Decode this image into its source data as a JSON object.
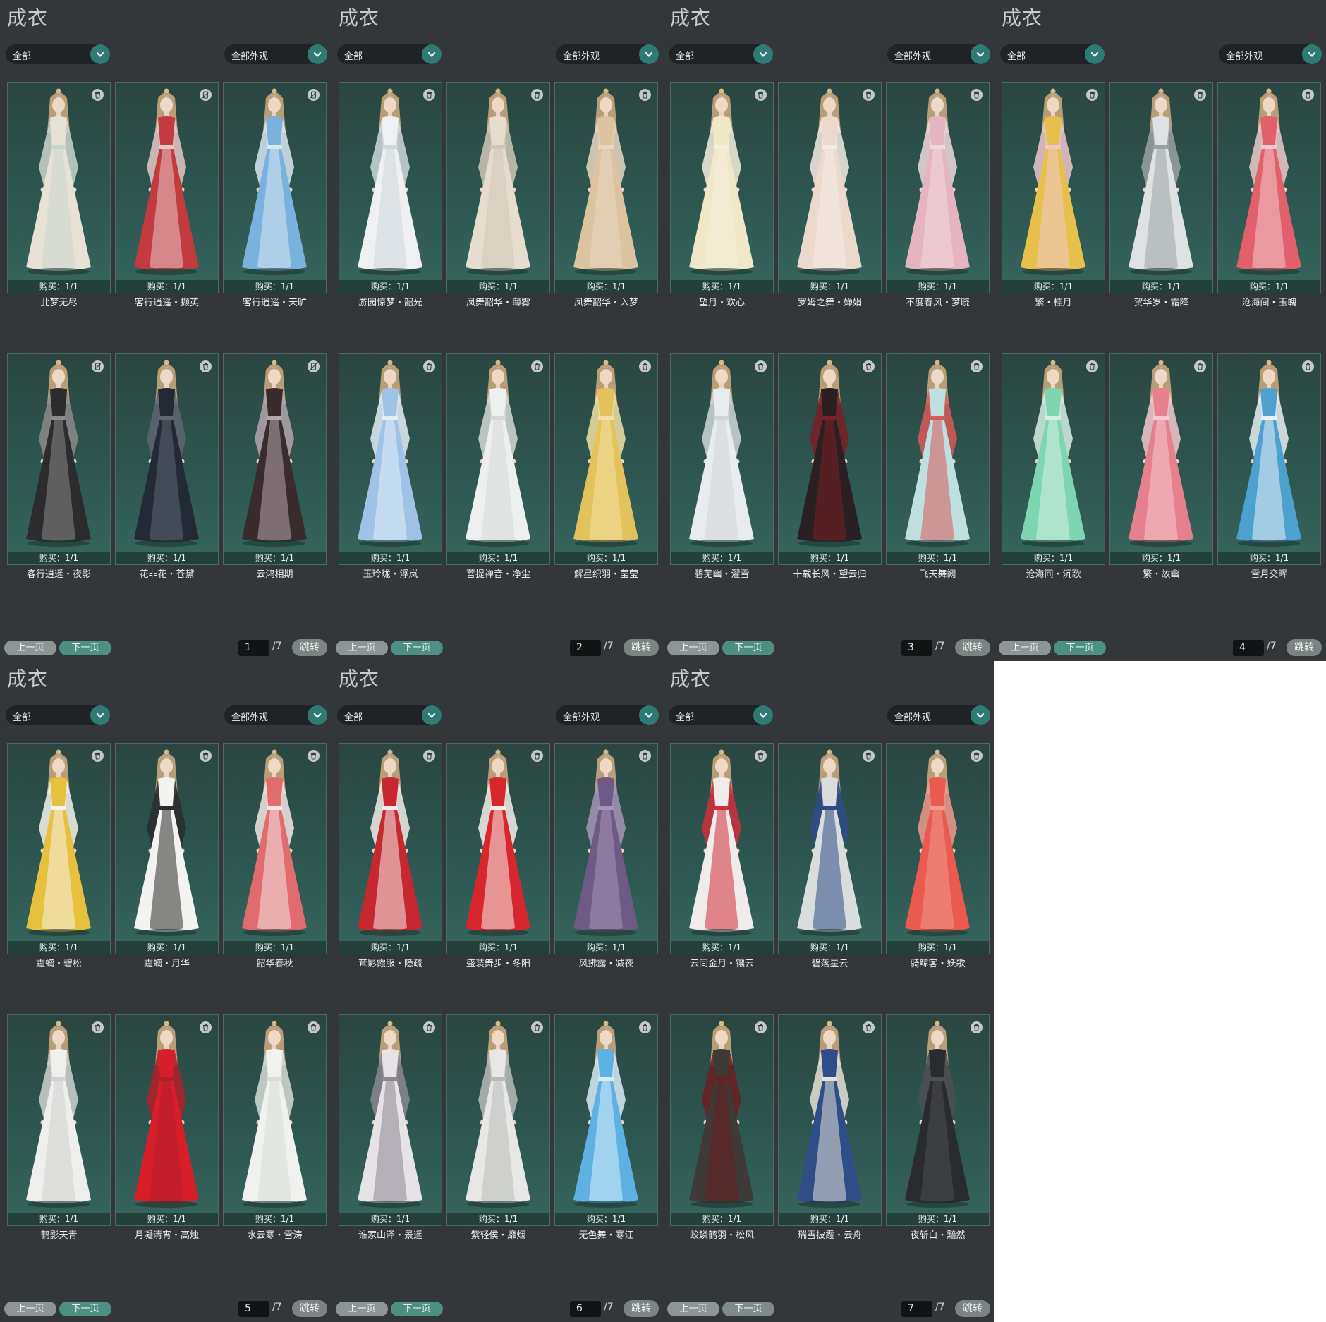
{
  "colors": {
    "panel_bg": "#34373a",
    "card_bg": "#2d5650",
    "accent": "#2f7a74",
    "next_button": "#4d8f83",
    "prev_button": "#8d9695"
  },
  "panels": [
    {
      "title": "成衣",
      "filter_left": "全部",
      "filter_right": "全部外观",
      "items": [
        {
          "name": "此梦无尽",
          "purchase": "购买：1/1",
          "palette": [
            "#e8e2d6",
            "#c9d6cf"
          ]
        },
        {
          "name": "客行逍遥・撷英",
          "purchase": "购买：1/1",
          "palette": [
            "#c23b3f",
            "#e6c7c8"
          ]
        },
        {
          "name": "客行逍遥・天旷",
          "purchase": "购买：1/1",
          "palette": [
            "#78b2dd",
            "#d8e8f1"
          ]
        },
        {
          "name": "客行逍遥・夜影",
          "purchase": "购买：1/1",
          "palette": [
            "#2c2c2f",
            "#8c8a88"
          ]
        },
        {
          "name": "花非花・苍黛",
          "purchase": "购买：1/1",
          "palette": [
            "#232a36",
            "#5f6671"
          ]
        },
        {
          "name": "云鸿相期",
          "purchase": "购买：1/1",
          "palette": [
            "#3a2c2c",
            "#b2a6ad"
          ]
        }
      ],
      "pagination": {
        "prev_label": "上一页",
        "next_label": "下一页",
        "current_page": "1",
        "total": "/7",
        "jump_label": "跳转"
      }
    },
    {
      "title": "成衣",
      "filter_left": "全部",
      "filter_right": "全部外观",
      "items": [
        {
          "name": "游园惊梦・韶光",
          "purchase": "购买：1/1",
          "palette": [
            "#eef0f2",
            "#cfd7dc"
          ]
        },
        {
          "name": "凤舞韶华・薄雾",
          "purchase": "购买：1/1",
          "palette": [
            "#e6ddcf",
            "#cfc7b8"
          ]
        },
        {
          "name": "凤舞韶华・入梦",
          "purchase": "购买：1/1",
          "palette": [
            "#dcc39f",
            "#e8d8bf"
          ]
        },
        {
          "name": "玉玲珑・浮岚",
          "purchase": "购买：1/1",
          "palette": [
            "#9fc3e6",
            "#e3eef7"
          ]
        },
        {
          "name": "菩提禅音・净尘",
          "purchase": "购买：1/1",
          "palette": [
            "#eef0ef",
            "#d5d8d6"
          ]
        },
        {
          "name": "解星织羽・莹莹",
          "purchase": "购买：1/1",
          "palette": [
            "#e4c25b",
            "#f1e1a4"
          ]
        }
      ],
      "pagination": {
        "prev_label": "上一页",
        "next_label": "下一页",
        "current_page": "2",
        "total": "/7",
        "jump_label": "跳转"
      }
    },
    {
      "title": "成衣",
      "filter_left": "全部",
      "filter_right": "全部外观",
      "items": [
        {
          "name": "望月・欢心",
          "purchase": "购买：1/1",
          "palette": [
            "#efe7c6",
            "#f4efdd"
          ]
        },
        {
          "name": "罗姆之舞・婵娟",
          "purchase": "购买：1/1",
          "palette": [
            "#ecd9ce",
            "#f3ebe6"
          ]
        },
        {
          "name": "不度春风・梦晓",
          "purchase": "购买：1/1",
          "palette": [
            "#e6b4c1",
            "#f0d9dd"
          ]
        },
        {
          "name": "碧芜幽・濯雪",
          "purchase": "购买：1/1",
          "palette": [
            "#e9ecee",
            "#cfd6d9"
          ]
        },
        {
          "name": "十载长风・望云归",
          "purchase": "购买：1/1",
          "palette": [
            "#2a1f22",
            "#7a1f27"
          ]
        },
        {
          "name": "飞天舞阙",
          "purchase": "购买：1/1",
          "palette": [
            "#bfe0e0",
            "#d95a5a"
          ]
        }
      ],
      "pagination": {
        "prev_label": "上一页",
        "next_label": "下一页",
        "current_page": "3",
        "total": "/7",
        "jump_label": "跳转"
      }
    },
    {
      "title": "成衣",
      "filter_left": "全部",
      "filter_right": "全部外观",
      "items": [
        {
          "name": "繁・桂月",
          "purchase": "购买：1/1",
          "palette": [
            "#e7c04b",
            "#efc6cc"
          ]
        },
        {
          "name": "贺华岁・霜降",
          "purchase": "购买：1/1",
          "palette": [
            "#dfe2e2",
            "#9aa2a2"
          ]
        },
        {
          "name": "沧海间・玉魄",
          "purchase": "购买：1/1",
          "palette": [
            "#e25f6c",
            "#f0c9cd"
          ]
        },
        {
          "name": "沧海间・沉歌",
          "purchase": "购买：1/1",
          "palette": [
            "#7fd5b1",
            "#d6efe5"
          ]
        },
        {
          "name": "繁・故幽",
          "purchase": "购买：1/1",
          "palette": [
            "#e7808e",
            "#f3c9cf"
          ]
        },
        {
          "name": "雪月交晖",
          "purchase": "购买：1/1",
          "palette": [
            "#4ea1cf",
            "#e7f0f5"
          ]
        }
      ],
      "pagination": {
        "prev_label": "上一页",
        "next_label": "下一页",
        "current_page": "4",
        "total": "/7",
        "jump_label": "跳转"
      }
    },
    {
      "title": "成衣",
      "filter_left": "全部",
      "filter_right": "全部外观",
      "items": [
        {
          "name": "霆螭・碧松",
          "purchase": "购买：1/1",
          "palette": [
            "#e7c13d",
            "#f5f3ec"
          ]
        },
        {
          "name": "霆螭・月华",
          "purchase": "购买：1/1",
          "palette": [
            "#f3f3f1",
            "#2b2b2b"
          ]
        },
        {
          "name": "韶华春秋",
          "purchase": "购买：1/1",
          "palette": [
            "#e16c6f",
            "#f3e6e4"
          ]
        },
        {
          "name": "鹤影天青",
          "purchase": "购买：1/1",
          "palette": [
            "#eeeeec",
            "#cfd2d0"
          ]
        },
        {
          "name": "月凝清宵・高烛",
          "purchase": "购买：1/1",
          "palette": [
            "#d81e2b",
            "#b0202a"
          ]
        },
        {
          "name": "水云寒・雪涛",
          "purchase": "购买：1/1",
          "palette": [
            "#f1f2ef",
            "#d6dcd6"
          ]
        }
      ],
      "pagination": {
        "prev_label": "上一页",
        "next_label": "下一页",
        "current_page": "5",
        "total": "/7",
        "jump_label": "跳转"
      }
    },
    {
      "title": "成衣",
      "filter_left": "全部",
      "filter_right": "全部外观",
      "items": [
        {
          "name": "茸影霞服・隐疏",
          "purchase": "购买：1/1",
          "palette": [
            "#c7282f",
            "#f2ebe7"
          ]
        },
        {
          "name": "盛装舞步・冬阳",
          "purchase": "购买：1/1",
          "palette": [
            "#d8262e",
            "#f4eee9"
          ]
        },
        {
          "name": "风拂露・减夜",
          "purchase": "购买：1/1",
          "palette": [
            "#6f5a86",
            "#a596b6"
          ]
        },
        {
          "name": "谁家山泽・景遥",
          "purchase": "购买：1/1",
          "palette": [
            "#e6e3e6",
            "#8c8791"
          ]
        },
        {
          "name": "紫轻侯・靡烟",
          "purchase": "购买：1/1",
          "palette": [
            "#e7e8e6",
            "#b9bbb9"
          ]
        },
        {
          "name": "无色舞・寒江",
          "purchase": "购买：1/1",
          "palette": [
            "#5fb1e4",
            "#d7ecf7"
          ]
        }
      ],
      "pagination": {
        "prev_label": "上一页",
        "next_label": "下一页",
        "current_page": "6",
        "total": "/7",
        "jump_label": "跳转"
      }
    },
    {
      "title": "成衣",
      "filter_left": "全部",
      "filter_right": "全部外观",
      "items": [
        {
          "name": "云间金月・镶云",
          "purchase": "购买：1/1",
          "palette": [
            "#f1ecec",
            "#d0303d"
          ]
        },
        {
          "name": "碧落星云",
          "purchase": "购买：1/1",
          "palette": [
            "#d9ddde",
            "#2f4b86"
          ]
        },
        {
          "name": "骑鲸客・妖歌",
          "purchase": "购买：1/1",
          "palette": [
            "#ea5a4f",
            "#f19a8e"
          ]
        },
        {
          "name": "蛟鳞鹤羽・松风",
          "purchase": "购买：1/1",
          "palette": [
            "#3d3a38",
            "#6e1d22"
          ]
        },
        {
          "name": "瑞雪披霞・云舟",
          "purchase": "购买：1/1",
          "palette": [
            "#2f4e88",
            "#e6e0d6"
          ]
        },
        {
          "name": "夜斩白・黯然",
          "purchase": "购买：1/1",
          "palette": [
            "#2a2b2e",
            "#4d4f53"
          ]
        }
      ],
      "pagination": {
        "prev_label": "上一页",
        "next_label": "下一页",
        "current_page": "7",
        "total": "/7",
        "jump_label": "跳转"
      }
    }
  ]
}
